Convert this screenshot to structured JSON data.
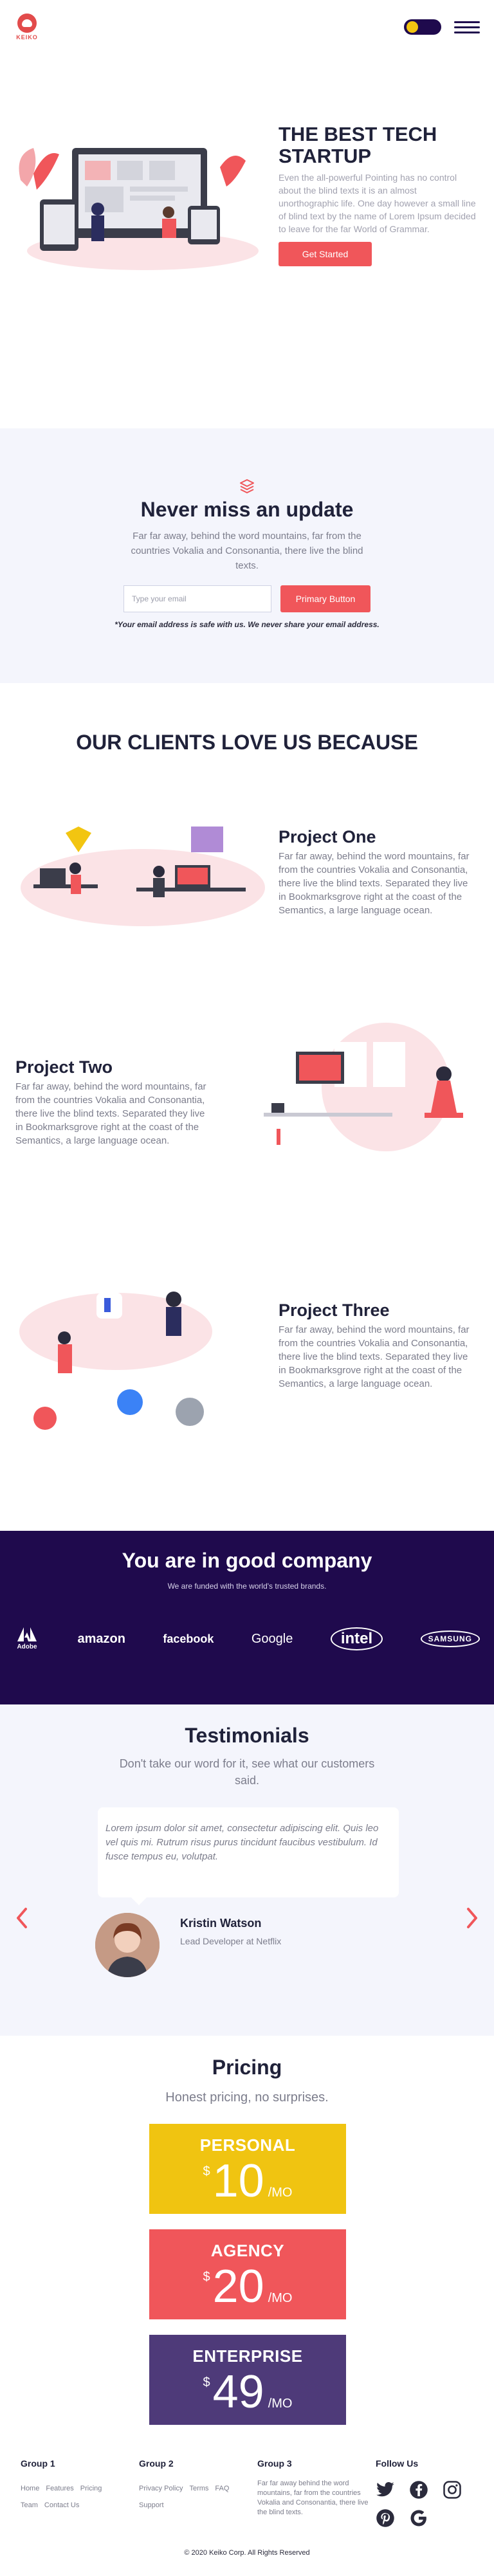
{
  "header": {
    "logo_text": "KEIKO",
    "colors": {
      "toggle_bg": "#1f0a4d",
      "toggle_knob": "#f2c511"
    }
  },
  "hero": {
    "title": "THE BEST TECH STARTUP",
    "body": "Even the all-powerful Pointing has no control about the blind texts it is an almost unorthographic life. One day however a small line of blind text by the name of Lorem Ipsum decided to leave for the far World of Grammar.",
    "cta_label": "Get Started"
  },
  "newsletter": {
    "title": "Never miss an update",
    "body": "Far far away, behind the word mountains, far from the countries Vokalia and Consonantia, there live the blind texts.",
    "email_placeholder": "Type your email",
    "button_label": "Primary Button",
    "note": "*Your email address is safe with us. We never share your email address."
  },
  "clients": {
    "title": "OUR CLIENTS LOVE US BECAUSE",
    "projects": [
      {
        "title": "Project One",
        "body": "Far far away, behind the word mountains, far from the countries Vokalia and Consonantia, there live the blind texts. Separated they live in Bookmarksgrove right at the coast of the Semantics, a large language ocean."
      },
      {
        "title": "Project Two",
        "body": "Far far away, behind the word mountains, far from the countries Vokalia and Consonantia, there live the blind texts. Separated they live in Bookmarksgrove right at the coast of the Semantics, a large language ocean."
      },
      {
        "title": "Project Three",
        "body": "Far far away, behind the word mountains, far from the countries Vokalia and Consonantia, there live the blind texts. Separated they live in Bookmarksgrove right at the coast of the Semantics, a large language ocean."
      }
    ]
  },
  "company": {
    "title": "You are in good company",
    "subtitle": "We are funded with the world's trusted brands.",
    "brands": [
      "Adobe",
      "amazon",
      "facebook",
      "Google",
      "intel",
      "SAMSUNG"
    ]
  },
  "testimonials": {
    "title": "Testimonials",
    "subtitle": "Don't take our word for it, see what our customers said.",
    "quote": "Lorem ipsum dolor sit amet, consectetur adipiscing elit. Quis leo vel quis mi. Rutrum risus purus tincidunt faucibus vestibulum. Id fusce tempus eu, volutpat.",
    "name": "Kristin Watson",
    "role": "Lead Developer at Netflix"
  },
  "pricing": {
    "title": "Pricing",
    "subtitle": "Honest pricing, no surprises.",
    "plans": [
      {
        "name": "PERSONAL",
        "currency": "$",
        "amount": "10",
        "period": "/MO",
        "color": "#f0c411"
      },
      {
        "name": "AGENCY",
        "currency": "$",
        "amount": "20",
        "period": "/MO",
        "color": "#f0565a"
      },
      {
        "name": "ENTERPRISE",
        "currency": "$",
        "amount": "49",
        "period": "/MO",
        "color": "#4e3a79"
      }
    ]
  },
  "footer": {
    "group1": {
      "title": "Group 1",
      "links": [
        "Home",
        "Features",
        "Pricing",
        "Team",
        "Contact Us"
      ]
    },
    "group2": {
      "title": "Group 2",
      "links": [
        "Privacy Policy",
        "Terms",
        "FAQ",
        "Support"
      ]
    },
    "group3": {
      "title": "Group 3",
      "text": "Far far away behind the word mountains, far from the countries Vokalia and Consonantia, there live the blind texts."
    },
    "social": {
      "title": "Follow Us",
      "icons": [
        "twitter-icon",
        "facebook-icon",
        "instagram-icon",
        "pinterest-icon",
        "google-icon"
      ]
    },
    "copyright": "© 2020 Keiko Corp. All Rights Reserved"
  }
}
